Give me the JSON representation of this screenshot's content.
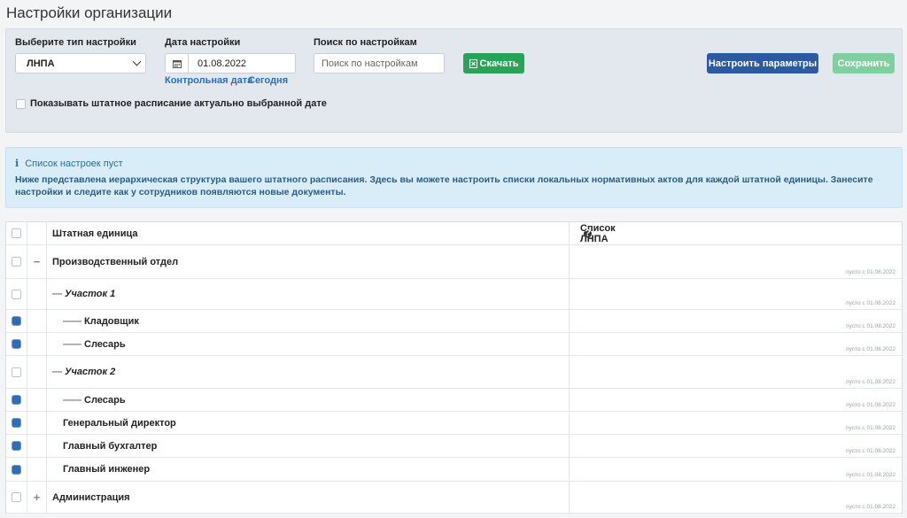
{
  "page": {
    "title": "Настройки организации"
  },
  "filters": {
    "type_label": "Выберите тип настройки",
    "type_value": "ЛНПА",
    "date_label": "Дата настройки",
    "date_value": "01.08.2022",
    "link_control": "Контрольная дата",
    "link_today": "Сегодня",
    "search_label": "Поиск по настройкам",
    "search_placeholder": "Поиск по настройкам",
    "download_label": "Скачать",
    "configure_label": "Настроить параметры",
    "save_label": "Сохранить",
    "show_schedule_label": "Показывать штатное расписание актуально выбранной дате",
    "show_schedule_checked": false
  },
  "info": {
    "title": "Список настроек пуст",
    "text": "Ниже представлена иерархическая структура вашего штатного расписания. Здесь вы можете настроить списки локальных нормативных актов для каждой штатной единицы. Занесите настройки и следите как у сотрудников появляются новые документы."
  },
  "table": {
    "col_unit": "Штатная единица",
    "col_list": "Список ЛНПА",
    "rows": [
      {
        "name": "Производственный отдел",
        "checked": false,
        "toggle": "−",
        "level": 0,
        "italic": false,
        "status": "пусто с 01.08.2022"
      },
      {
        "name": "Участок 1",
        "checked": false,
        "toggle": "",
        "level": 1,
        "italic": true,
        "status": "пусто с 01.08.2022"
      },
      {
        "name": "Кладовщик",
        "checked": true,
        "toggle": "",
        "level": 2,
        "italic": false,
        "status": "пусто с 01.08.2022"
      },
      {
        "name": "Слесарь",
        "checked": true,
        "toggle": "",
        "level": 2,
        "italic": false,
        "status": "пусто с 01.08.2022"
      },
      {
        "name": "Участок 2",
        "checked": false,
        "toggle": "",
        "level": 1,
        "italic": true,
        "status": "пусто с 01.08.2022"
      },
      {
        "name": "Слесарь",
        "checked": true,
        "toggle": "",
        "level": 2,
        "italic": false,
        "status": "пусто с 01.08.2022"
      },
      {
        "name": "Генеральный директор",
        "checked": true,
        "toggle": "",
        "level": 3,
        "italic": false,
        "status": "пусто с 01.08.2022"
      },
      {
        "name": "Главный бухгалтер",
        "checked": true,
        "toggle": "",
        "level": 3,
        "italic": false,
        "status": "пусто с 01.08.2022"
      },
      {
        "name": "Главный инженер",
        "checked": true,
        "toggle": "",
        "level": 3,
        "italic": false,
        "status": "пусто с 01.08.2022"
      },
      {
        "name": "Администрация",
        "checked": false,
        "toggle": "+",
        "level": 0,
        "italic": false,
        "status": "пусто с 01.08.2022"
      }
    ]
  }
}
